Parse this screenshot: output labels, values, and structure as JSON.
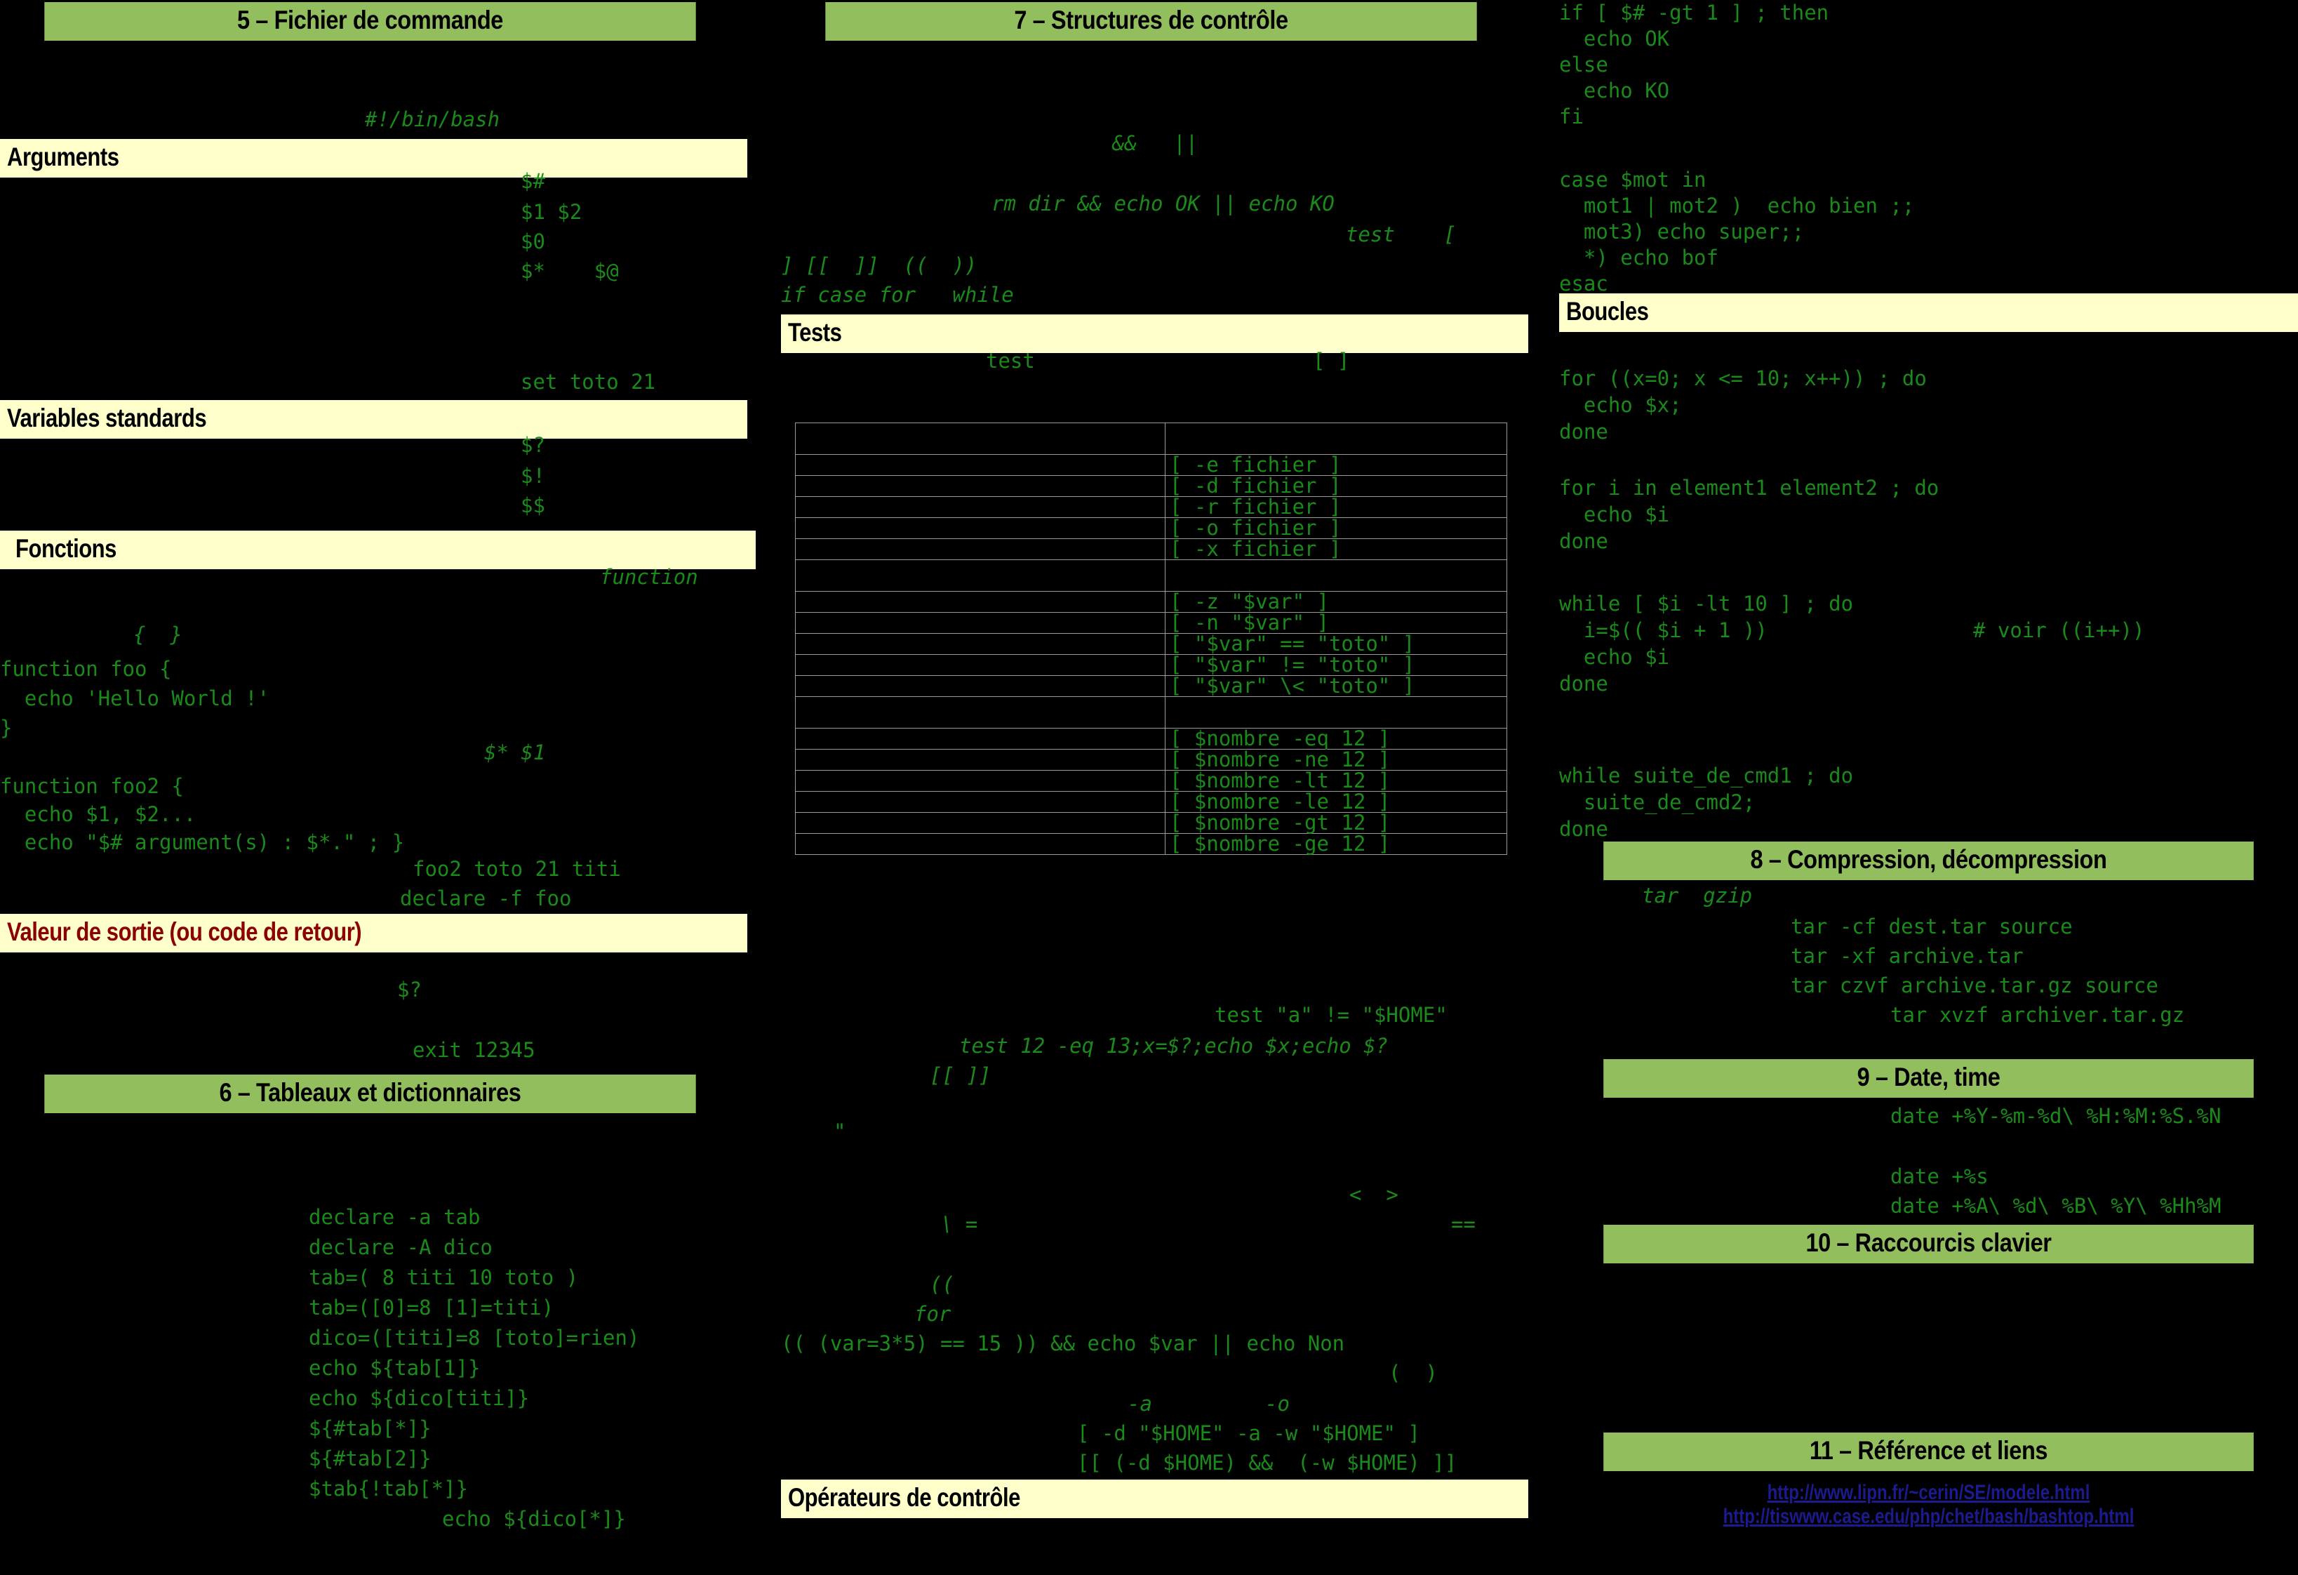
{
  "colors": {
    "section_header_bg": "#92be5e",
    "sub_header_bg": "#ffffcc",
    "code_green": "#1a8a1a",
    "page_bg": "#000000",
    "link_blue": "#1b1b8f",
    "red_title": "#8b0000"
  },
  "left_column": {
    "section_title": "5 – Fichier de commande",
    "shebang": "#!/bin/bash",
    "sub_arguments": "Arguments",
    "args_lines": [
      "$#",
      "$1 $2",
      "$0",
      "$*    $@"
    ],
    "set_line": "set toto 21",
    "sub_variables": "Variables standards",
    "vars_lines": [
      "$?",
      "$!",
      "$$"
    ],
    "sub_fonctions": "Fonctions",
    "function_kw": "function",
    "braces": "{  }",
    "foo_block": "function foo {\n  echo 'Hello World !'\n}",
    "star_one": "$* $1",
    "foo2_block": "function foo2 {\n  echo $1, $2...\n  echo \"$# argument(s) : $*.\" ; }",
    "foo2_call": "foo2 toto 21 titi",
    "declare_f": "declare -f foo",
    "sub_valeur": "Valeur de sortie (ou code de retour)",
    "retour_var": "$?",
    "exit_line": "exit 12345",
    "section_title_6": "6 – Tableaux et dictionnaires",
    "tab_lines": [
      "declare -a tab",
      "declare -A dico",
      "tab=( 8 titi 10 toto )",
      "tab=([0]=8 [1]=titi)",
      "dico=([titi]=8 [toto]=rien)",
      "echo ${tab[1]}",
      "echo ${dico[titi]}",
      "${#tab[*]}",
      "${#tab[2]}",
      "$tab{!tab[*]}"
    ],
    "dico_star": "echo ${dico[*]}"
  },
  "middle_column": {
    "section_title": "7 – Structures de contrôle",
    "and_or": "&&   ||",
    "rm_example": "rm dir && echo OK || echo KO",
    "test_bracket": "test    [",
    "brackets_line": "] [[  ]]  ((  ))",
    "keywords_line": "if case for   while",
    "sub_tests": "Tests",
    "test_word": "test",
    "empty_brackets": "[ ]",
    "table_rows": [
      {
        "left": "",
        "right": "",
        "tall": true
      },
      {
        "left": "",
        "right": "[ -e fichier ]"
      },
      {
        "left": "",
        "right": "[ -d fichier ]"
      },
      {
        "left": "",
        "right": "[ -r fichier ]"
      },
      {
        "left": "",
        "right": "[ -o fichier ]"
      },
      {
        "left": "",
        "right": "[ -x fichier ]"
      },
      {
        "left": "",
        "right": "",
        "tall": true
      },
      {
        "left": "",
        "right": "[ -z \"$var\" ]"
      },
      {
        "left": "",
        "right": "[ -n \"$var\" ]"
      },
      {
        "left": "",
        "right": "[ \"$var\" == \"toto\" ]"
      },
      {
        "left": "",
        "right": "[ \"$var\" != \"toto\" ]"
      },
      {
        "left": "",
        "right": "[ \"$var\" \\< \"toto\" ]"
      },
      {
        "left": "",
        "right": "",
        "tall": true
      },
      {
        "left": "",
        "right": "[ $nombre -eq 12 ]"
      },
      {
        "left": "",
        "right": "[ $nombre -ne 12 ]"
      },
      {
        "left": "",
        "right": "[ $nombre -lt 12 ]"
      },
      {
        "left": "",
        "right": "[ $nombre -le 12 ]"
      },
      {
        "left": "",
        "right": "[ $nombre -gt 12 ]"
      },
      {
        "left": "",
        "right": "[ $nombre -ge 12 ]"
      }
    ],
    "test_home": "test \"a\" != \"$HOME\"",
    "test_eq": "test 12 -eq 13;x=$?;echo $x;echo $?",
    "dbl_brackets": "[[ ]]",
    "quote": "\"",
    "lt_gt": "<  >",
    "backslash_eq": "\\ =",
    "eq_eq": "==",
    "dbl_paren": "((",
    "for_kw": "for",
    "arith_example": "(( (var=3*5) == 15 )) && echo $var || echo Non",
    "paren": "(  )",
    "minus_a": "-a",
    "minus_o": "-o",
    "test_and": "[ -d \"$HOME\" -a -w \"$HOME\" ]",
    "test_and2": "[[ (-d $HOME) &&  (-w $HOME) ]]",
    "sub_operateurs": "Opérateurs de contrôle"
  },
  "right_column": {
    "if_block": "if [ $# -gt 1 ] ; then\n  echo OK\nelse\n  echo KO\nfi",
    "case_block": "case $mot in\n  mot1 | mot2 )  echo bien ;;\n  mot3) echo super;;\n  *) echo bof\nesac",
    "sub_boucles": "Boucles",
    "for_c_block": "for ((x=0; x <= 10; x++)) ; do\n  echo $x;\ndone",
    "for_in_block": "for i in element1 element2 ; do\n  echo $i\ndone",
    "while_block_line1": "while [ $i -lt 10 ] ; do",
    "while_block_line2": "  i=$(( $i + 1 ))",
    "while_comment": "# voir ((i++))",
    "while_block_line3": "  echo $i",
    "while_block_line4": "done",
    "while_cmd_block": "while suite_de_cmd1 ; do\n  suite_de_cmd2;\ndone",
    "section_title_8": "8 – Compression, décompression",
    "tar_gzip": "tar  gzip",
    "tar_lines": [
      "tar -cf dest.tar source",
      "tar -xf archive.tar",
      "tar czvf archive.tar.gz source"
    ],
    "tar_xvzf": "tar xvzf archiver.tar.gz",
    "section_title_9": "9 – Date, time",
    "date_full": "date +%Y-%m-%d\\ %H:%M:%S.%N",
    "date_s": "date +%s",
    "date_long": "date +%A\\ %d\\ %B\\ %Y\\ %Hh%M",
    "section_title_10": "10 – Raccourcis clavier",
    "section_title_11": "11 – Référence et liens",
    "links": [
      "http://www.lipn.fr/~cerin/SE/modele.html",
      "http://tiswww.case.edu/php/chet/bash/bashtop.html"
    ]
  }
}
